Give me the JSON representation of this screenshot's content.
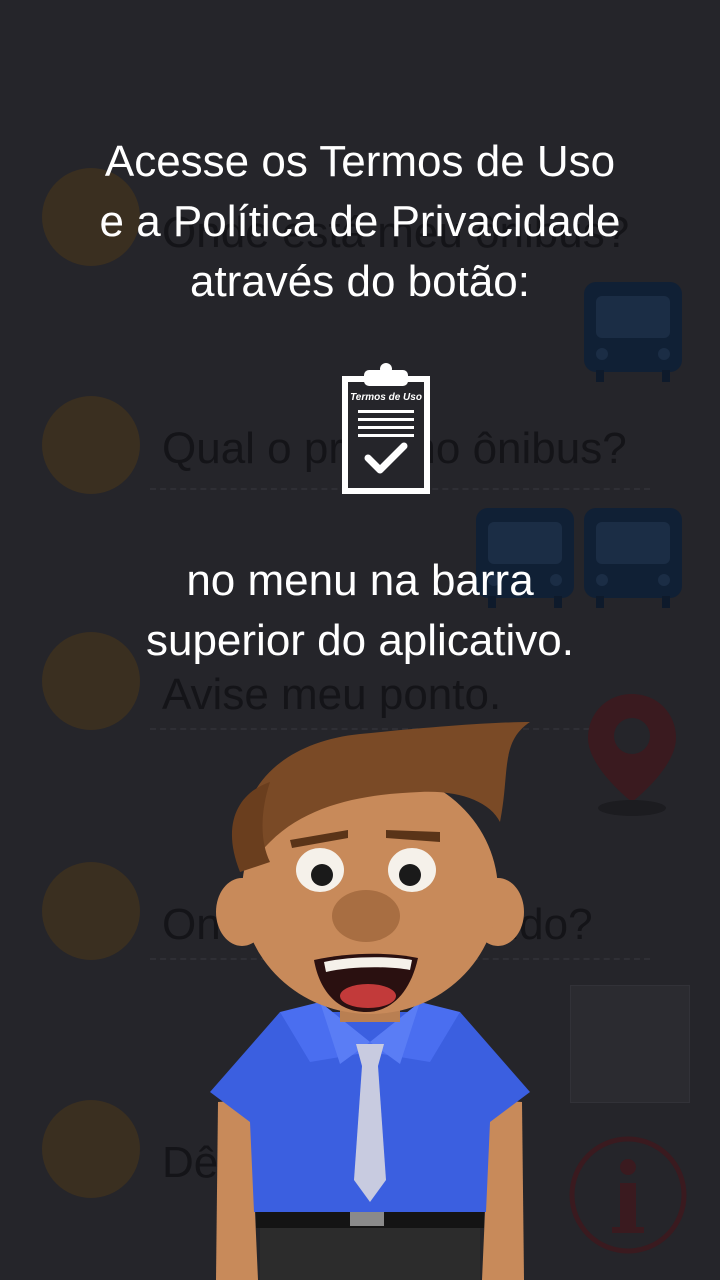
{
  "background_menu": {
    "items": [
      {
        "label": "Onde está meu ônibus?"
      },
      {
        "label": "Qual o próximo ônibus?"
      },
      {
        "label": "Avise meu ponto."
      },
      {
        "label": "Onde está passando?"
      },
      {
        "label": "Dê sua opinião."
      }
    ]
  },
  "tutorial": {
    "top_text": "Acesse os Termos de Uso\ne a Política de Privacidade\natravés do botão:",
    "terms_icon_label": "Termos de Uso",
    "bottom_text": "no menu na barra\nsuperior do aplicativo."
  },
  "colors": {
    "overlay_background": "#25252a",
    "text": "#ffffff",
    "shirt": "#3b5fe0"
  },
  "icons": [
    "bus-icon",
    "map-pin-icon",
    "map-thumbnail",
    "info-icon",
    "terms-of-use-icon",
    "mascot-character"
  ]
}
